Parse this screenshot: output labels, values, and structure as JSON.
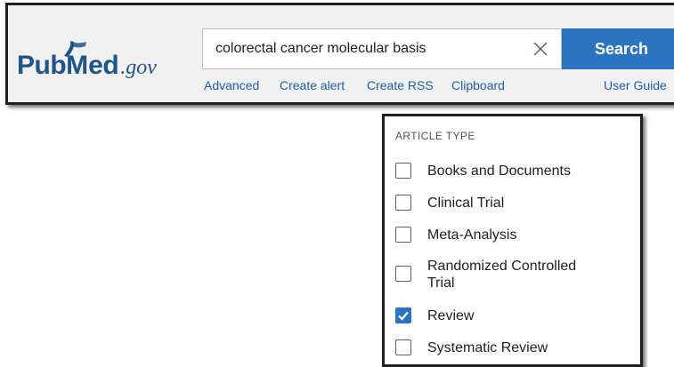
{
  "logo": {
    "word_start": "Pub",
    "letter_m": "M",
    "word_end": "ed",
    "domain": ".gov",
    "brand_color": "#20558a"
  },
  "search": {
    "query": "colorectal cancer molecular basis",
    "clear_icon": "close-icon",
    "button_label": "Search",
    "button_color": "#2b74c2"
  },
  "links": {
    "advanced": "Advanced",
    "create_alert": "Create alert",
    "create_rss": "Create RSS",
    "clipboard": "Clipboard",
    "user_guide": "User Guide",
    "link_color": "#1a5ea8"
  },
  "article_type": {
    "heading": "ARTICLE TYPE",
    "options": [
      {
        "label": "Books and Documents",
        "checked": false
      },
      {
        "label": "Clinical Trial",
        "checked": false
      },
      {
        "label": "Meta-Analysis",
        "checked": false
      },
      {
        "label": "Randomized Controlled Trial",
        "checked": false
      },
      {
        "label": "Review",
        "checked": true
      },
      {
        "label": "Systematic Review",
        "checked": false
      }
    ]
  }
}
